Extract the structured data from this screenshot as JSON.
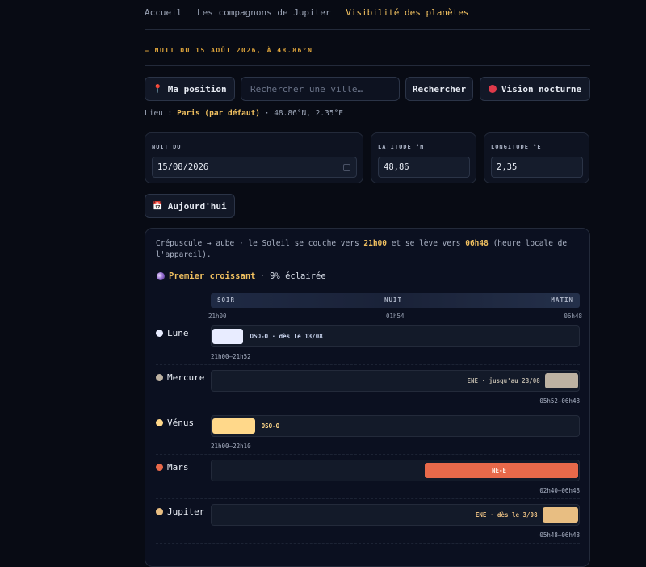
{
  "breadcrumb": [
    "Accueil",
    "Les compagnons de Jupiter",
    "Visibilité des planètes"
  ],
  "night_heading": "— NUIT DU 15 AOÛT 2026, À 48.86°N",
  "controls": {
    "my_position": "Ma position",
    "search_placeholder": "Rechercher une ville…",
    "search_button": "Rechercher",
    "night_vision": "Vision nocturne"
  },
  "location": {
    "prefix": "Lieu :",
    "name": "Paris (par défaut)",
    "coords": "· 48.86°N, 2.35°E"
  },
  "fields": {
    "night_label": "NUIT DU",
    "night_value": "15/08/2026",
    "lat_label": "LATITUDE °N",
    "lat_value": "48,86",
    "lon_label": "LONGITUDE °E",
    "lon_value": "2,35"
  },
  "today_button": "Aujourd'hui",
  "summary": {
    "part1": "Crépuscule → aube · le Soleil se couche vers ",
    "sunset": "21h00",
    "part2": " et se lève vers ",
    "sunrise": "06h48",
    "part3": " (heure locale de l'appareil)."
  },
  "moon_phase": {
    "name": "Premier croissant",
    "illum": "· 9% éclairée"
  },
  "timeline": {
    "soir": "SOIR",
    "nuit": "NUIT",
    "matin": "MATIN",
    "t_start": "21h00",
    "t_mid": "01h54",
    "t_end": "06h48"
  },
  "planets": [
    {
      "name": "Lune",
      "color": "#e8ecff",
      "label": "OSO-O · dès le 13/08",
      "time": "21h00–21h52",
      "start": 0.0,
      "end": 0.089,
      "label_side": "right"
    },
    {
      "name": "Mercure",
      "color": "#bdb2a2",
      "label": "ENE · jusqu'au 23/08",
      "time": "05h52–06h48",
      "start": 0.905,
      "end": 1.0,
      "label_side": "left"
    },
    {
      "name": "Vénus",
      "color": "#ffd88a",
      "label": "OSO-O",
      "time": "21h00–22h10",
      "start": 0.0,
      "end": 0.12,
      "label_side": "right"
    },
    {
      "name": "Mars",
      "color": "#e8694a",
      "label": "NE-E",
      "time": "02h40–06h48",
      "start": 0.578,
      "end": 1.0,
      "label_side": "inside"
    },
    {
      "name": "Jupiter",
      "color": "#e8be82",
      "label": "ENE · dès le 3/08",
      "time": "05h48–06h48",
      "start": 0.898,
      "end": 1.0,
      "label_side": "left"
    }
  ]
}
